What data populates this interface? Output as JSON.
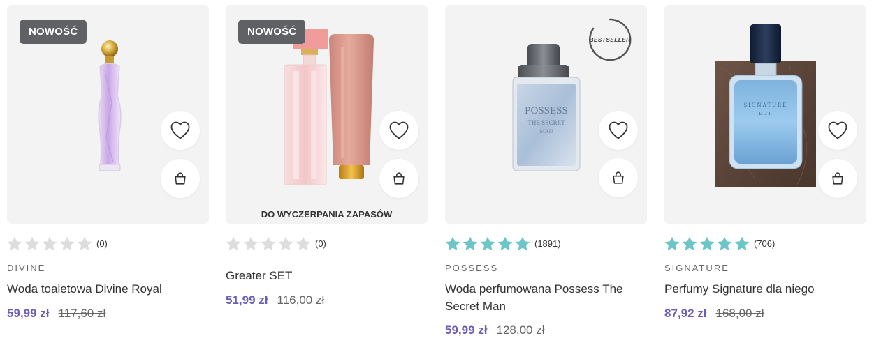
{
  "colors": {
    "card_bg": "#f3f3f3",
    "badge_bg": "#5f6164",
    "price_accent": "#6b5fb5",
    "star_filled": "#6cc5c7",
    "star_empty": "#dddddd"
  },
  "products": [
    {
      "badge": "NOWOŚĆ",
      "rating_count": "(0)",
      "rating_stars": 0,
      "brand": "DIVINE",
      "name": "Woda toaletowa Divine Royal",
      "price": "59,99 zł",
      "old_price": "117,60 zł",
      "icons": [
        "heart-icon",
        "shopping-bag-icon"
      ]
    },
    {
      "badge": "NOWOŚĆ",
      "stock_note": "DO WYCZERPANIA ZAPASÓW",
      "rating_count": "(0)",
      "rating_stars": 0,
      "name": "Greater SET",
      "price": "51,99 zł",
      "old_price": "116,00 zł",
      "icons": [
        "heart-icon",
        "shopping-bag-icon"
      ]
    },
    {
      "bestseller": "BESTSELLER",
      "rating_count": "(1891)",
      "rating_stars": 5,
      "brand": "POSSESS",
      "name": "Woda perfumowana Possess The Secret Man",
      "price": "59,99 zł",
      "old_price": "128,00 zł",
      "icons": [
        "heart-icon",
        "shopping-bag-icon"
      ]
    },
    {
      "rating_count": "(706)",
      "rating_stars": 5,
      "brand": "SIGNATURE",
      "name": "Perfumy Signature dla niego",
      "price": "87,92 zł",
      "old_price": "168,00 zł",
      "icons": [
        "heart-icon",
        "shopping-bag-icon"
      ]
    }
  ]
}
